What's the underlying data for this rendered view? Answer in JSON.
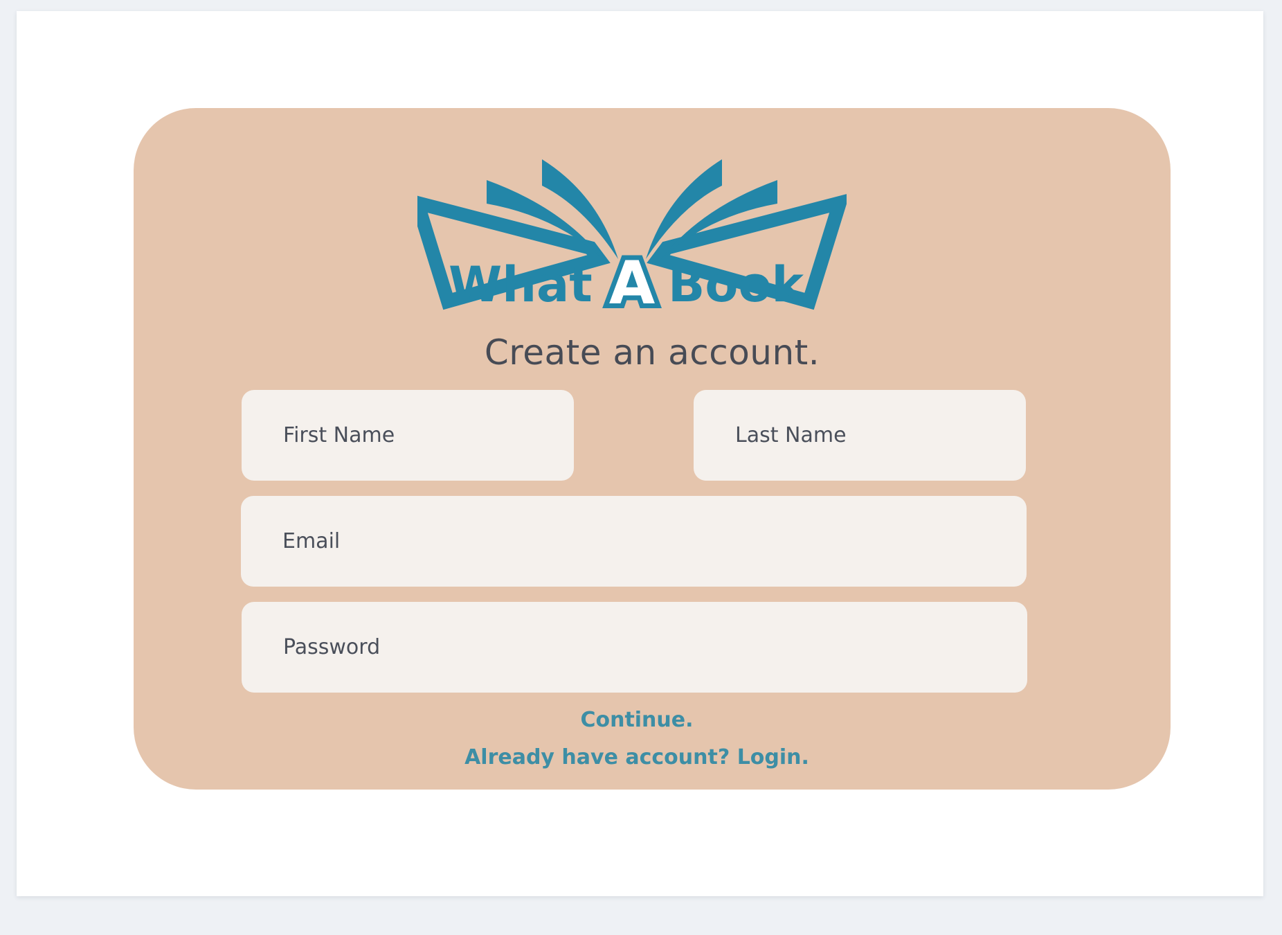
{
  "logo": {
    "alt_text": "WhatABook",
    "word_left": "What",
    "word_center": "A",
    "word_right": "Book",
    "icon": "open-book-logo-icon",
    "color": "#2386a8"
  },
  "heading": {
    "title": "Create an account."
  },
  "form": {
    "first_name_placeholder": "First Name",
    "last_name_placeholder": "Last Name",
    "email_placeholder": "Email",
    "password_placeholder": "Password"
  },
  "actions": {
    "continue_label": "Continue.",
    "login_label": "Already have account? Login."
  },
  "colors": {
    "card_background": "#e5c5ad",
    "input_background": "#f5f1ed",
    "link_color": "#3d8ea5",
    "title_color": "#474b55"
  }
}
